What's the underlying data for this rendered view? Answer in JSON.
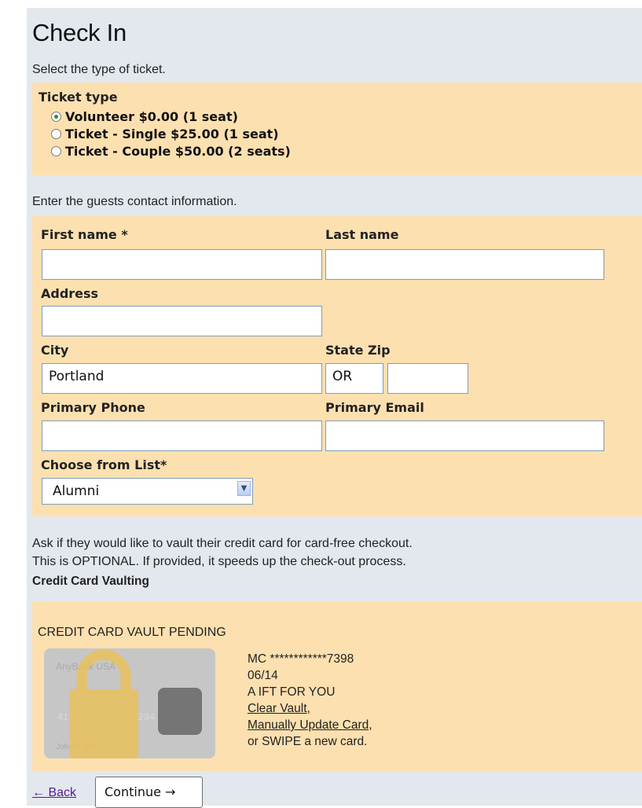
{
  "page": {
    "title": "Check In",
    "ticket_instruction": "Select the type of ticket.",
    "contact_instruction": "Enter the guests contact information."
  },
  "ticket": {
    "label": "Ticket type",
    "options": [
      {
        "label": "Volunteer $0.00 (1 seat)",
        "selected": true
      },
      {
        "label": "Ticket - Single $25.00 (1 seat)",
        "selected": false
      },
      {
        "label": "Ticket - Couple $50.00 (2 seats)",
        "selected": false
      }
    ]
  },
  "contact": {
    "first_name_label": "First name *",
    "first_name_value": "",
    "last_name_label": "Last name",
    "last_name_value": "",
    "address_label": "Address",
    "address_value": "",
    "city_label": "City",
    "city_value": "Portland",
    "state_zip_label": "State Zip",
    "state_value": "OR",
    "zip_value": "",
    "phone_label": "Primary Phone",
    "phone_value": "",
    "email_label": "Primary Email",
    "email_value": "",
    "list_label": "Choose from List*",
    "list_value": "Alumni"
  },
  "vault": {
    "note_line1": "Ask if they would like to vault their credit card for card-free checkout.",
    "note_line2": "This is OPTIONAL. If provided, it speeds up the check-out process.",
    "section_label": "Credit Card Vaulting",
    "status": "CREDIT CARD VAULT PENDING",
    "card_bank": "AnyBank USA",
    "card_number_img": "4111 0123 1234 1234",
    "card_holder": "John A. Doe",
    "card_masked": "MC ************7398",
    "card_expiry": "06/14",
    "card_name": "A IFT FOR YOU",
    "clear_link": "Clear Vault,",
    "update_link": "Manually Update Card,",
    "swipe_text": "or SWIPE a new card."
  },
  "nav": {
    "back_label": "← Back",
    "continue_label": "Continue →"
  },
  "colors": {
    "page_bg": "#e3e7ee",
    "box_bg": "#fde0b0",
    "link": "#1a1aff"
  }
}
